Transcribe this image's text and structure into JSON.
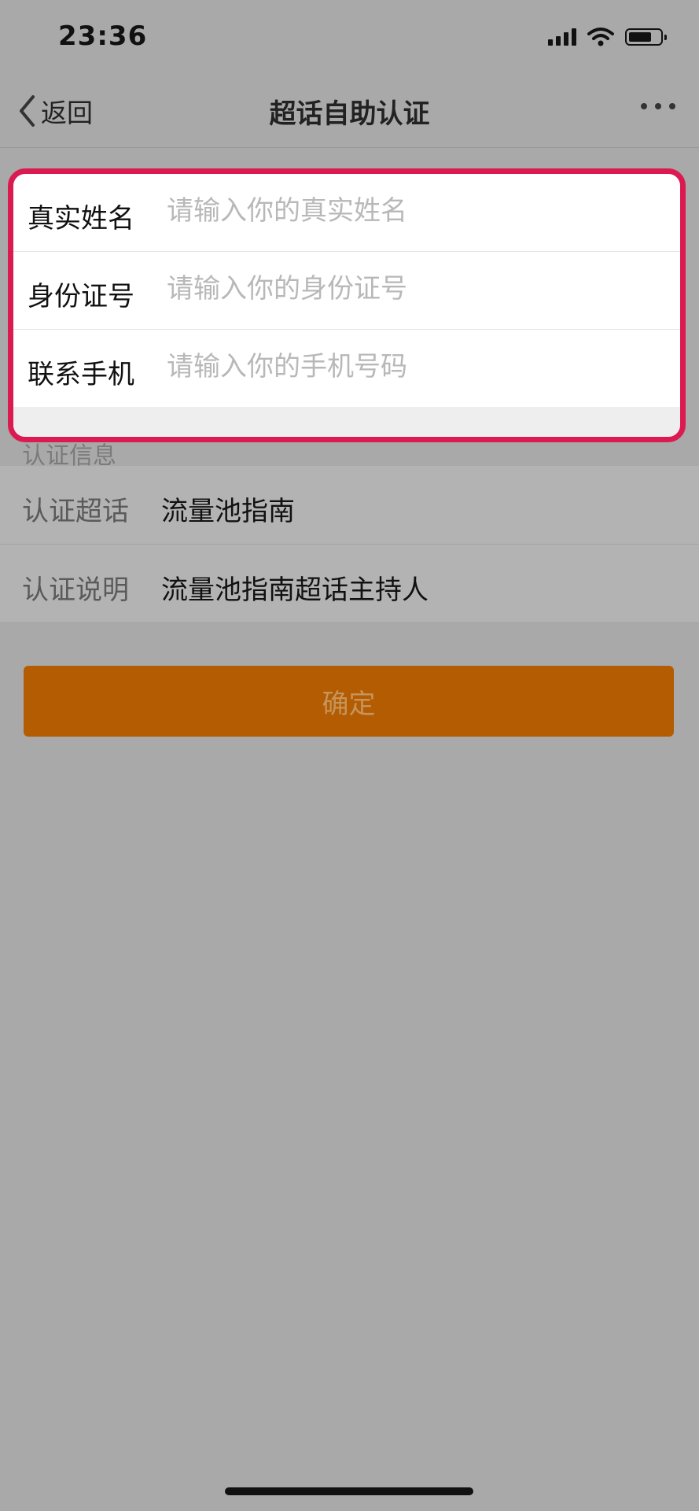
{
  "status_bar": {
    "time": "23:36"
  },
  "nav": {
    "back_label": "返回",
    "title": "超话自助认证"
  },
  "form": {
    "fields": [
      {
        "label": "真实姓名",
        "placeholder": "请输入你的真实姓名",
        "value": ""
      },
      {
        "label": "身份证号",
        "placeholder": "请输入你的身份证号",
        "value": ""
      },
      {
        "label": "联系手机",
        "placeholder": "请输入你的手机号码",
        "value": ""
      }
    ]
  },
  "section": {
    "title": "认证信息"
  },
  "info": {
    "rows": [
      {
        "label": "认证超话",
        "value": "流量池指南"
      },
      {
        "label": "认证说明",
        "value": "流量池指南超话主持人"
      }
    ]
  },
  "confirm": {
    "label": "确定"
  },
  "colors": {
    "highlight_border": "#dc1a52",
    "button_bg": "#b35c02",
    "overlay": "#a9a9a9"
  }
}
